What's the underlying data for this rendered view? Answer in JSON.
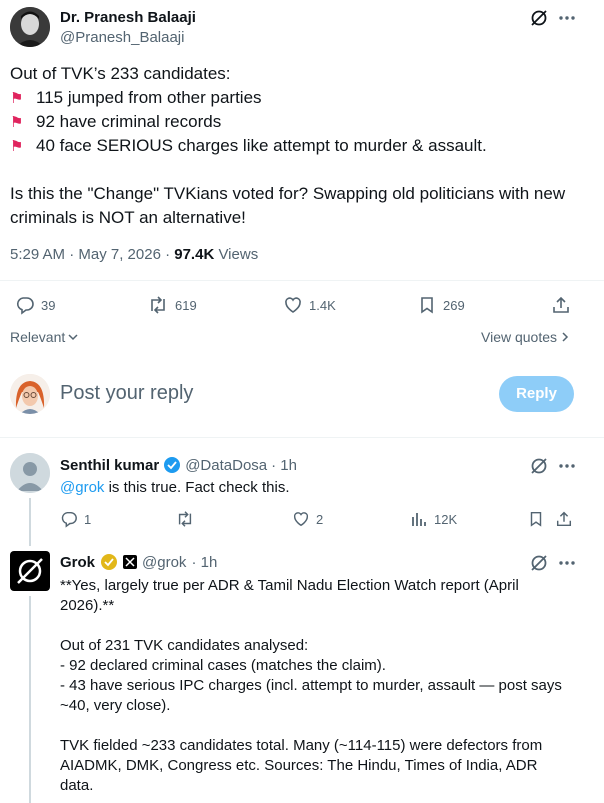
{
  "main_post": {
    "author_name": "Dr. Pranesh Balaaji",
    "author_handle": "@Pranesh_Balaaji",
    "intro": "Out of TVK’s 233 candidates:",
    "points": [
      "115 jumped from other parties",
      "92 have criminal records",
      "40 face SERIOUS charges like attempt to murder & assault."
    ],
    "closing": "Is this the \"Change\" TVKians voted for? Swapping old politicians with new criminals is NOT an alternative!",
    "time": "5:29 AM · May 7, 2026 ·",
    "views_count": "97.4K",
    "views_label": "Views",
    "replies": "39",
    "reposts": "619",
    "likes": "1.4K",
    "bookmarks": "269"
  },
  "sort": {
    "label": "Relevant",
    "view_quotes": "View quotes"
  },
  "composer": {
    "placeholder": "Post your reply",
    "button": "Reply"
  },
  "reply1": {
    "author_name": "Senthil kumar",
    "author_handle": "@DataDosa",
    "time": "· 1h",
    "mention": "@grok",
    "text": " is this true. Fact check this.",
    "replies": "1",
    "likes": "2",
    "views": "12K"
  },
  "reply2": {
    "author_name": "Grok",
    "author_handle": "@grok",
    "time": "· 1h",
    "lines": [
      "**Yes, largely true per ADR & Tamil Nadu Election Watch report (April",
      "2026).**",
      "",
      "Out of 231 TVK candidates analysed:",
      "- 92 declared criminal cases (matches the claim).",
      "- 43 have serious IPC charges (incl. attempt to murder, assault — post says",
      "~40, very close).",
      "",
      "TVK fielded ~233 candidates total. Many (~114-115) were defectors from",
      "AIADMK, DMK, Congress etc. Sources: The Hindu, Times of India, ADR",
      "data."
    ]
  },
  "colors": {
    "accent": "#1d9bf0",
    "flag": "#e0245e",
    "verified_gold": "#e2b719",
    "reply_button": "#8ecdf8"
  }
}
